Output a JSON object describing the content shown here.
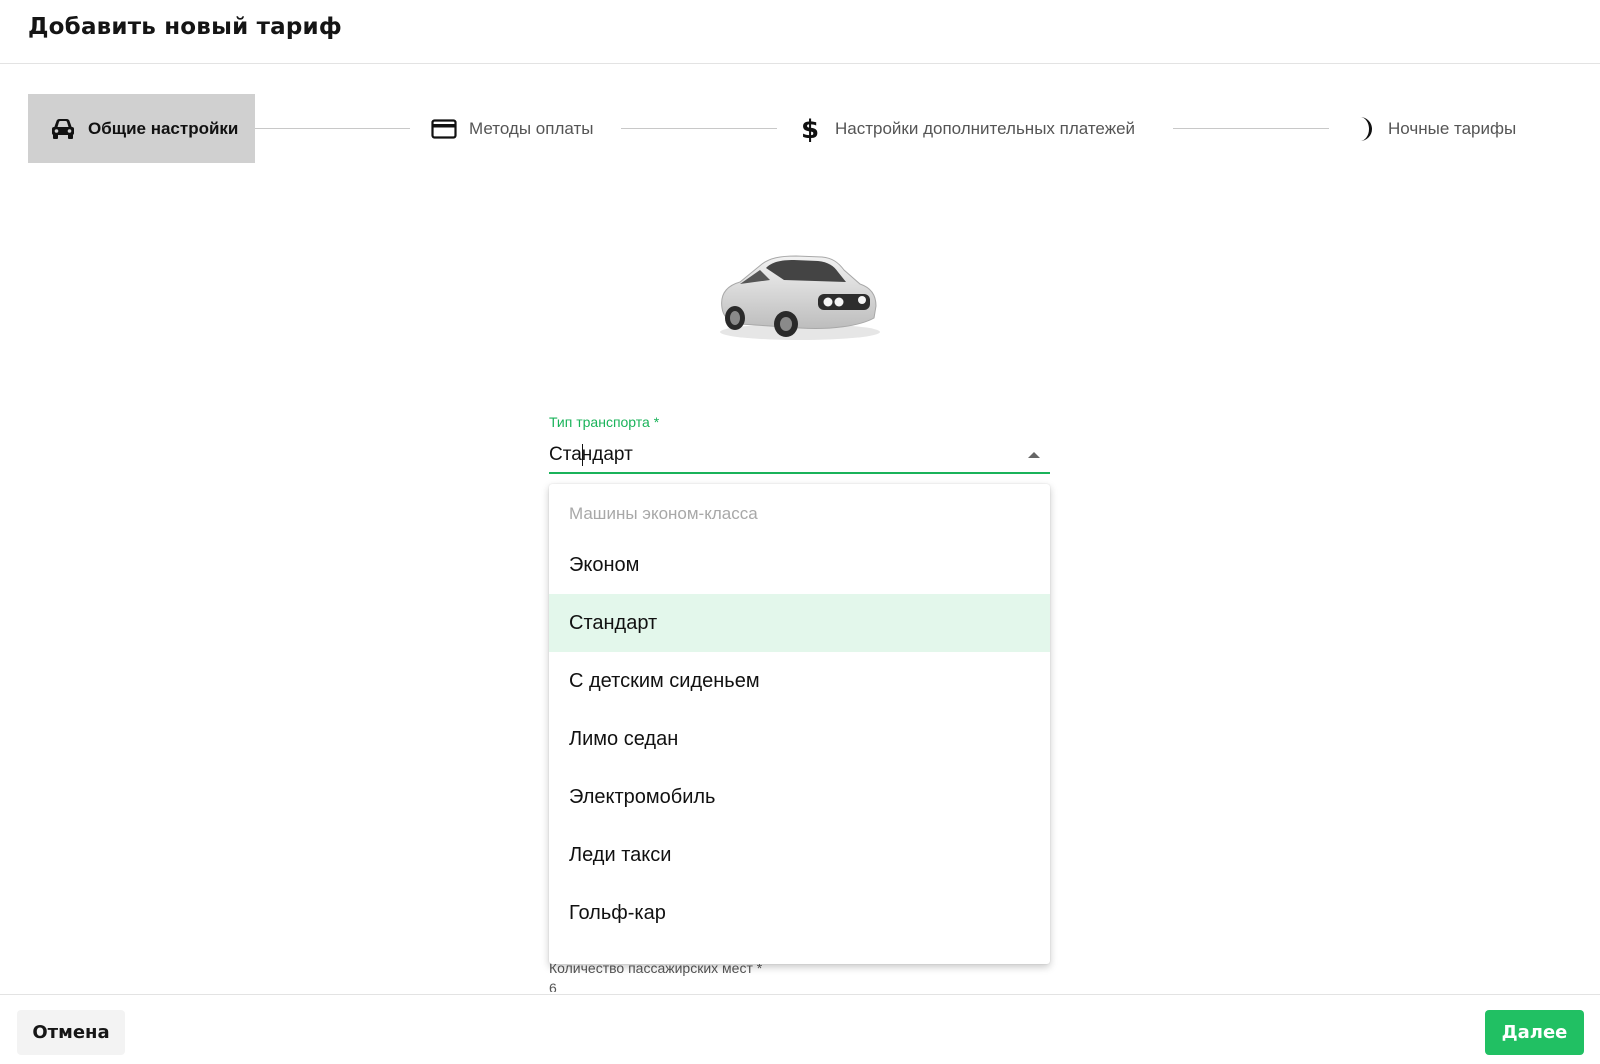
{
  "header": {
    "title": "Добавить новый тариф"
  },
  "steps": [
    {
      "label": "Общие настройки",
      "icon": "car-icon",
      "active": true
    },
    {
      "label": "Методы оплаты",
      "icon": "credit-card-icon",
      "active": false
    },
    {
      "label": "Настройки дополнительных платежей",
      "icon": "dollar-icon",
      "active": false
    },
    {
      "label": "Ночные тарифы",
      "icon": "moon-icon",
      "active": false
    }
  ],
  "transport_field": {
    "label": "Тип транспорта *",
    "value": "Стандарт"
  },
  "dropdown": {
    "group_label": "Машины эконом-класса",
    "options": [
      "Эконом",
      "Стандарт",
      "С детским сиденьем",
      "Лимо седан",
      "Электромобиль",
      "Леди такси",
      "Гольф-кар"
    ],
    "selected": "Стандарт"
  },
  "seats_field": {
    "label": "Количество пассажирских мест *",
    "value": "6"
  },
  "footer": {
    "cancel_label": "Отмена",
    "next_label": "Далее"
  },
  "colors": {
    "accent": "#21c063",
    "selected_bg": "#e3f7eb",
    "active_step_bg": "#d0d0d0"
  }
}
